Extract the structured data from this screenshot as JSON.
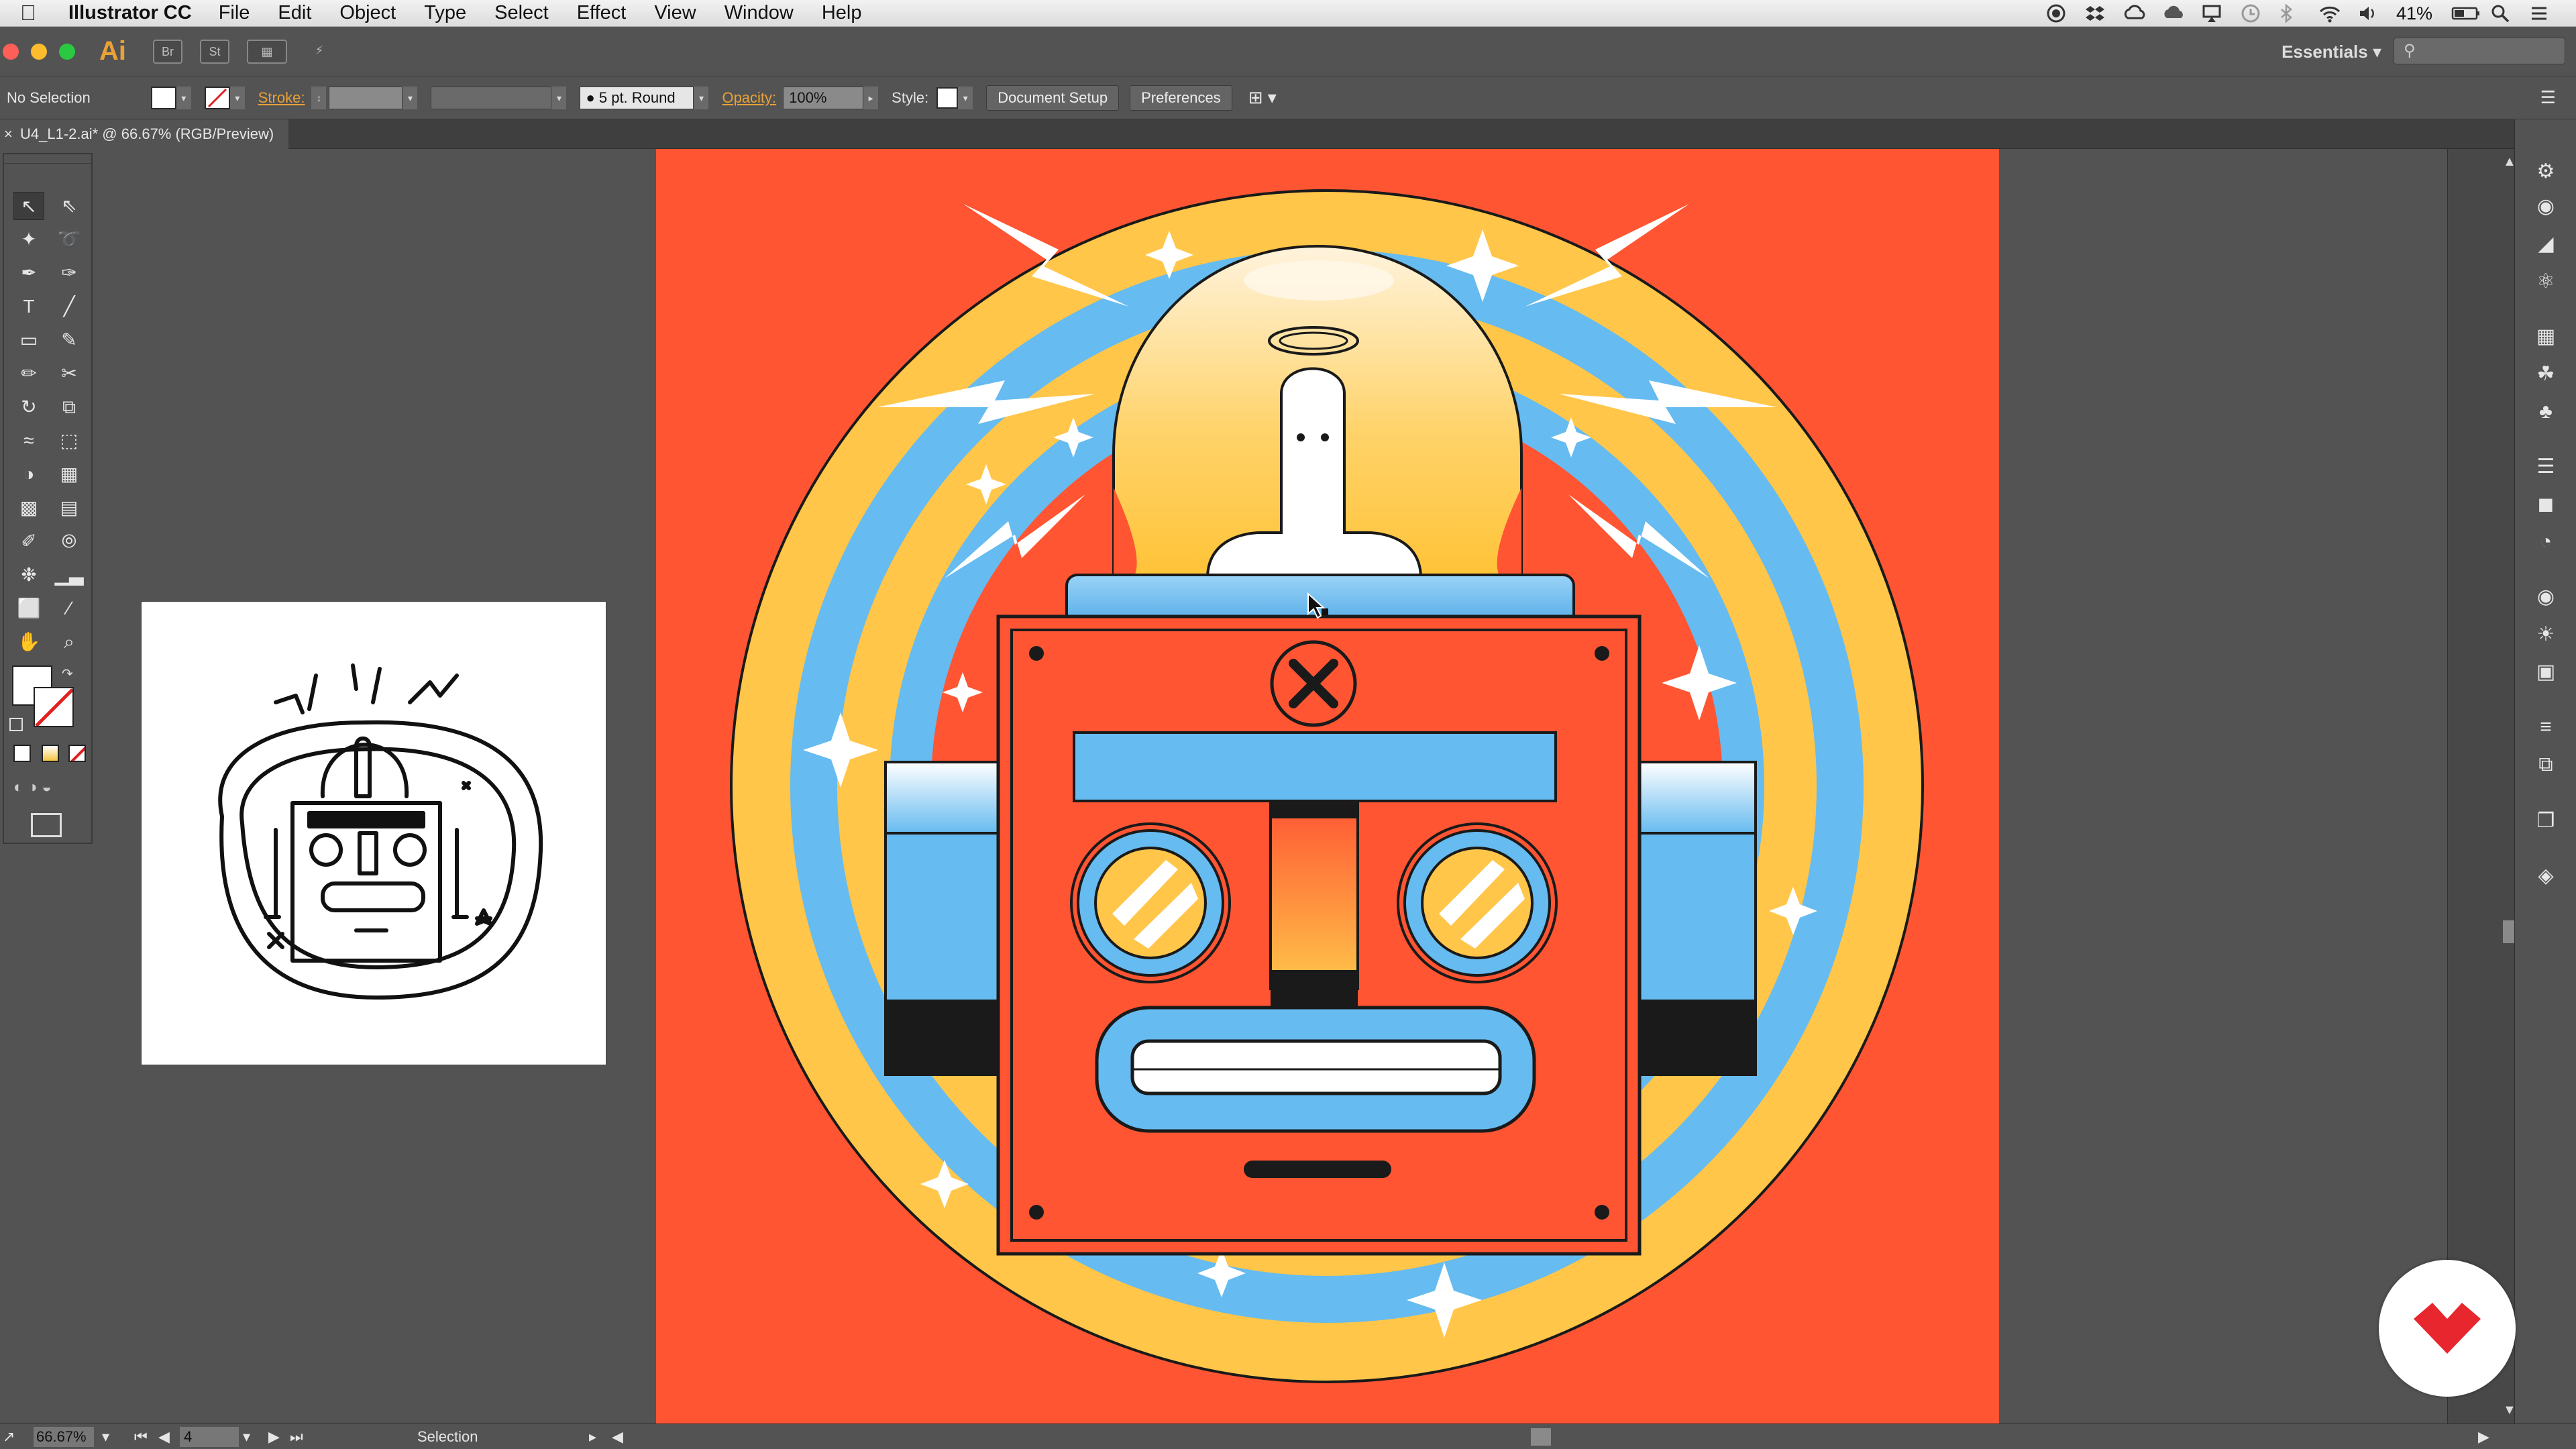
{
  "menubar": {
    "app_name": "Illustrator CC",
    "menus": [
      "File",
      "Edit",
      "Object",
      "Type",
      "Select",
      "Effect",
      "View",
      "Window",
      "Help"
    ],
    "battery": "41%"
  },
  "appbar": {
    "logo": "Ai",
    "bridge_label": "Br",
    "stock_label": "St",
    "workspace": "Essentials"
  },
  "control": {
    "selection": "No Selection",
    "stroke_label": "Stroke:",
    "brush": "5 pt. Round",
    "opacity_label": "Opacity:",
    "opacity_value": "100%",
    "style_label": "Style:",
    "document_setup": "Document Setup",
    "preferences": "Preferences"
  },
  "document": {
    "tab_title": "U4_L1-2.ai* @ 66.67% (RGB/Preview)"
  },
  "status": {
    "zoom": "66.67%",
    "artboard_number": "4",
    "current_tool": "Selection"
  },
  "colors": {
    "artboard_bg": "#ff5533",
    "yellow": "#ffc64a",
    "blue": "#66bbf0",
    "dark": "#1a1a1a",
    "brand_red": "#e8262e"
  },
  "icons": {
    "tools": [
      "selection-tool-icon",
      "direct-selection-tool-icon",
      "magic-wand-icon",
      "lasso-icon",
      "pen-tool-icon",
      "curvature-tool-icon",
      "type-tool-icon",
      "line-tool-icon",
      "rectangle-tool-icon",
      "paintbrush-icon",
      "shaper-tool-icon",
      "scissors-icon",
      "rotate-tool-icon",
      "scale-tool-icon",
      "warp-tool-icon",
      "free-transform-icon",
      "shape-builder-icon",
      "perspective-grid-icon",
      "mesh-tool-icon",
      "gradient-tool-icon",
      "eyedropper-icon",
      "blend-tool-icon",
      "symbol-sprayer-icon",
      "graph-tool-icon",
      "artboard-tool-icon",
      "slice-tool-icon",
      "hand-tool-icon",
      "zoom-tool-icon"
    ]
  }
}
